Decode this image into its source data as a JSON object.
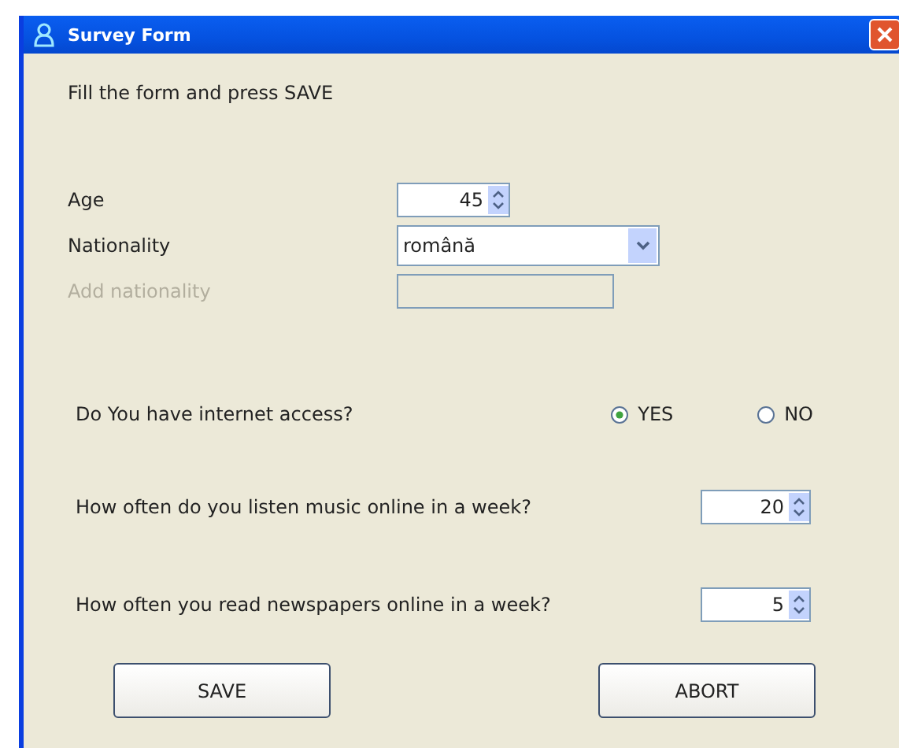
{
  "window": {
    "title": "Survey Form"
  },
  "intro": "Fill the form and press SAVE",
  "fields": [
    {
      "kind": "spinner",
      "label": "Age",
      "value": "45",
      "disabled": false
    },
    {
      "kind": "combo",
      "label": "Nationality",
      "value": "română",
      "disabled": false
    },
    {
      "kind": "text",
      "label": "Add nationality",
      "disabled": true
    }
  ],
  "internet_question": {
    "label": "Do You have internet access?",
    "options": [
      {
        "label": "YES",
        "selected": true
      },
      {
        "label": "NO",
        "selected": false
      }
    ]
  },
  "frequency_questions": [
    {
      "label": "How often do you listen music online in a week?",
      "value": "20"
    },
    {
      "label": "How often you read newspapers online in a week?",
      "value": "5"
    }
  ],
  "buttons": [
    "SAVE",
    "ABORT"
  ]
}
